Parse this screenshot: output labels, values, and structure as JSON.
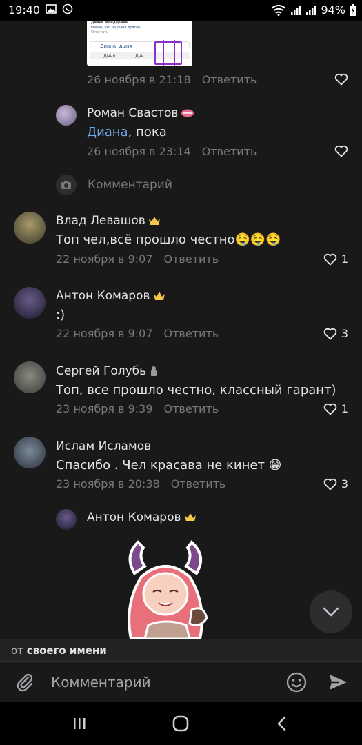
{
  "status_bar": {
    "time": "19:40",
    "battery": "94%"
  },
  "top_comment": {
    "meta_date": "26 ноября в 21:18",
    "reply": "Ответить"
  },
  "thumbnail": {
    "line1": "Диана Мандарина",
    "line2": "Роман, это не дыня драгон",
    "line3": "Ответить",
    "input_text": "Диана, дыня",
    "word1": "Дыня",
    "word2": "Дни"
  },
  "comments": [
    {
      "name": "Роман Свастов",
      "mention": "Диана",
      "text": ", пока",
      "date": "26 ноября в 23:14",
      "reply": "Ответить",
      "likes": ""
    },
    {
      "name": "Влад Левашов",
      "text": "Топ чел,всё прошло честно🤤🤤🤤",
      "date": "22 ноября в 9:07",
      "reply": "Ответить",
      "likes": "1"
    },
    {
      "name": "Антон Комаров",
      "text": ":)",
      "date": "22 ноября в 9:07",
      "reply": "Ответить",
      "likes": "3"
    },
    {
      "name": "Сергей Голубь",
      "text": "Топ, все прошло честно, классный гарант)",
      "date": "23 ноября в 9:39",
      "reply": "Ответить",
      "likes": "1"
    },
    {
      "name": "Ислам Исламов",
      "text": "Спасибо . Чел красава не кинет 😁",
      "date": "23 ноября в 20:38",
      "reply": "Ответить",
      "likes": "3"
    },
    {
      "name": "Антон Комаров"
    }
  ],
  "comment_input": {
    "placeholder": "Комментарий"
  },
  "from_bar": {
    "prefix": "от",
    "name": "своего имени"
  },
  "composer": {
    "placeholder": "Комментарий"
  },
  "colors": {
    "background": "#19191a",
    "link": "#71aaeb",
    "muted": "#76787a",
    "crown": "#f5c84b"
  },
  "icons": [
    "heart-icon",
    "camera-icon",
    "crown-icon",
    "chevron-down-icon",
    "paperclip-icon",
    "smiley-icon",
    "send-icon",
    "recent-apps-icon",
    "home-icon",
    "back-icon"
  ]
}
